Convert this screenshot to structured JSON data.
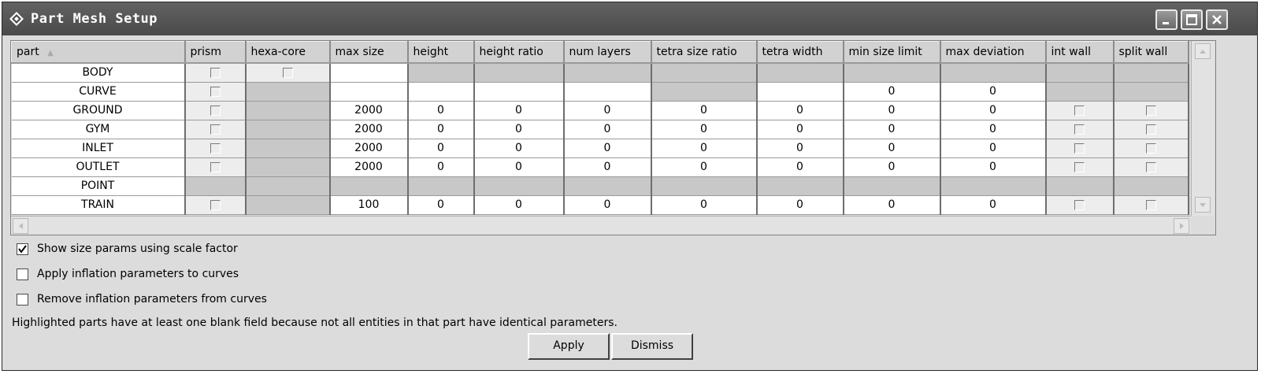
{
  "window": {
    "title": "Part Mesh Setup",
    "icon": "app-diamond-icon"
  },
  "columns": [
    "part",
    "prism",
    "hexa-core",
    "max size",
    "height",
    "height ratio",
    "num layers",
    "tetra size ratio",
    "tetra width",
    "min size limit",
    "max deviation",
    "int wall",
    "split wall"
  ],
  "sort_indicator": "▲",
  "rows": [
    {
      "part": "BODY",
      "max_size": "",
      "height": "",
      "height_ratio": "",
      "num_layers": "",
      "tetra_size_ratio": "",
      "tetra_width": "",
      "min_size_limit": "",
      "max_deviation": ""
    },
    {
      "part": "CURVE",
      "max_size": "",
      "height": "",
      "height_ratio": "",
      "num_layers": "",
      "tetra_size_ratio": "",
      "tetra_width": "",
      "min_size_limit": "0",
      "max_deviation": "0"
    },
    {
      "part": "GROUND",
      "max_size": "2000",
      "height": "0",
      "height_ratio": "0",
      "num_layers": "0",
      "tetra_size_ratio": "0",
      "tetra_width": "0",
      "min_size_limit": "0",
      "max_deviation": "0"
    },
    {
      "part": "GYM",
      "max_size": "2000",
      "height": "0",
      "height_ratio": "0",
      "num_layers": "0",
      "tetra_size_ratio": "0",
      "tetra_width": "0",
      "min_size_limit": "0",
      "max_deviation": "0"
    },
    {
      "part": "INLET",
      "max_size": "2000",
      "height": "0",
      "height_ratio": "0",
      "num_layers": "0",
      "tetra_size_ratio": "0",
      "tetra_width": "0",
      "min_size_limit": "0",
      "max_deviation": "0"
    },
    {
      "part": "OUTLET",
      "max_size": "2000",
      "height": "0",
      "height_ratio": "0",
      "num_layers": "0",
      "tetra_size_ratio": "0",
      "tetra_width": "0",
      "min_size_limit": "0",
      "max_deviation": "0"
    },
    {
      "part": "POINT",
      "max_size": "",
      "height": "",
      "height_ratio": "",
      "num_layers": "",
      "tetra_size_ratio": "",
      "tetra_width": "",
      "min_size_limit": "",
      "max_deviation": ""
    },
    {
      "part": "TRAIN",
      "max_size": "100",
      "height": "0",
      "height_ratio": "0",
      "num_layers": "0",
      "tetra_size_ratio": "0",
      "tetra_width": "0",
      "min_size_limit": "0",
      "max_deviation": "0"
    }
  ],
  "options": [
    {
      "label": "Show size params using scale factor",
      "checked": true
    },
    {
      "label": "Apply inflation parameters to curves",
      "checked": false
    },
    {
      "label": "Remove inflation parameters from curves",
      "checked": false
    }
  ],
  "note": "Highlighted parts have at least one blank field because not all entities in that part have identical parameters.",
  "buttons": {
    "apply": "Apply",
    "dismiss": "Dismiss"
  }
}
